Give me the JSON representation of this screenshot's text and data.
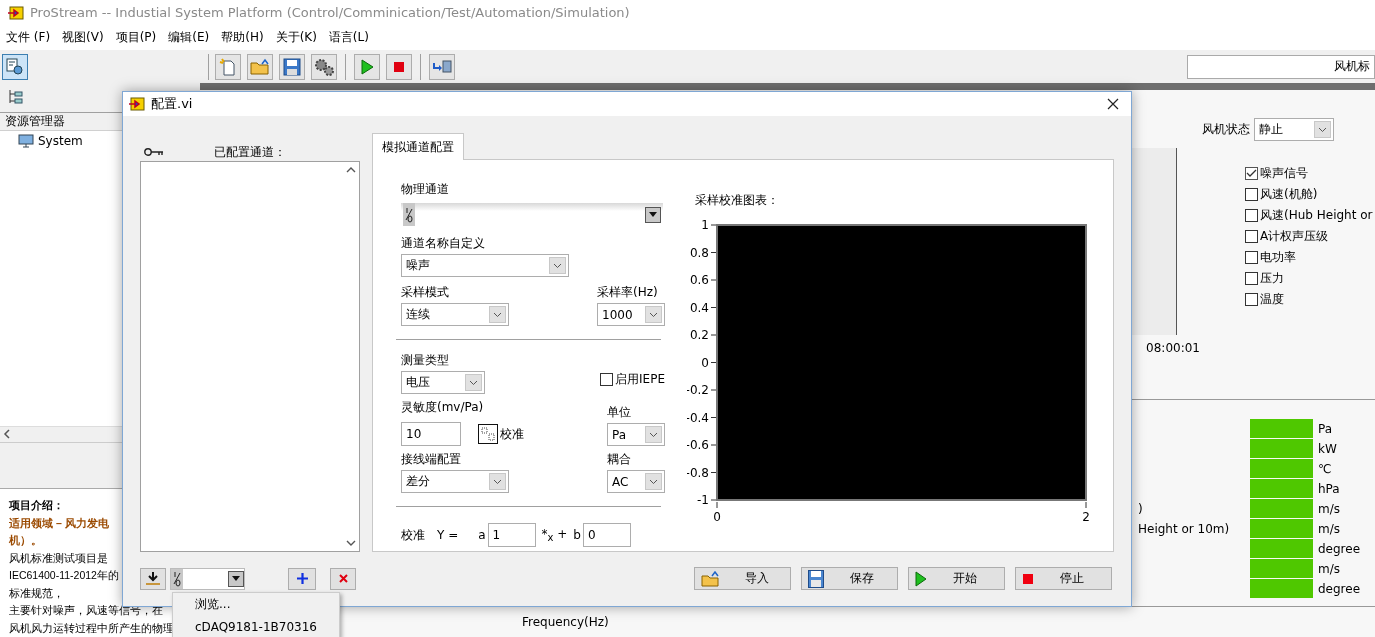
{
  "window": {
    "title": "ProStream -- Industial System Platform (Control/Comminication/Test/Automation/Simulation)"
  },
  "menu": [
    "文件 (F)",
    "视图(V)",
    "项目(P)",
    "编辑(E)",
    "帮助(H)",
    "关于(K)",
    "语言(L)"
  ],
  "toolbar": {
    "buttons": [
      {
        "kind": "explorer",
        "selected": true
      },
      {
        "kind": "new",
        "selected": false
      },
      {
        "kind": "open",
        "selected": false
      },
      {
        "kind": "save",
        "selected": false
      },
      {
        "kind": "settings",
        "selected": false
      },
      {
        "kind": "run",
        "selected": false
      },
      {
        "kind": "stop",
        "selected": false
      },
      {
        "kind": "export",
        "selected": false
      }
    ],
    "search_field": {
      "value": "风机标"
    }
  },
  "sidebar": {
    "header": "资源管理器",
    "items": [
      {
        "label": "System"
      }
    ]
  },
  "intro": {
    "title": "项目介绍：",
    "lines": [
      {
        "text": "适用领域 – 风力发电",
        "kind": "accent"
      },
      {
        "text": "机）。",
        "kind": "accent"
      },
      {
        "text": "风机标准测试项目是",
        "kind": "body"
      },
      {
        "text": "IEC61400-11-2012年的",
        "kind": "body"
      },
      {
        "text": "标准规范，",
        "kind": "body"
      },
      {
        "text": "主要针对噪声，风速等信号，在",
        "kind": "body"
      },
      {
        "text": "风机风力运转过程中所产生的物理",
        "kind": "body"
      }
    ]
  },
  "status": {
    "label": "风机状态",
    "value": "静止"
  },
  "signals": [
    {
      "label": "噪声信号",
      "checked": true
    },
    {
      "label": "风速(机舱)",
      "checked": false
    },
    {
      "label": "风速(Hub Height or",
      "checked": false
    },
    {
      "label": "A计权声压级",
      "checked": false
    },
    {
      "label": "电功率",
      "checked": false
    },
    {
      "label": "压力",
      "checked": false
    },
    {
      "label": "温度",
      "checked": false
    }
  ],
  "time_tick": "08:00:01",
  "legend_lines": [
    ")",
    "Height or 10m)"
  ],
  "units": [
    "Pa",
    "kW",
    "℃",
    "hPa",
    "m/s",
    "m/s",
    "degree",
    "m/s",
    "degree"
  ],
  "frequency_label": "Frequency(Hz)",
  "dialog": {
    "title": "配置.vi",
    "configured_label": "已配置通道：",
    "tabs": [
      {
        "label": "模拟通道配置",
        "selected": true
      }
    ],
    "form": {
      "physical_channel": {
        "label": "物理通道"
      },
      "channel_name": {
        "label": "通道名称自定义",
        "value": "噪声"
      },
      "sample_mode": {
        "label": "采样模式",
        "value": "连续"
      },
      "sample_rate": {
        "label": "采样率(Hz)",
        "value": "1000"
      },
      "measure_type": {
        "label": "测量类型",
        "value": "电压"
      },
      "iepe": {
        "label": "启用IEPE",
        "checked": false
      },
      "sensitivity": {
        "label": "灵敏度(mv/Pa)",
        "value": "10"
      },
      "calibrate_button": "校准",
      "unit": {
        "label": "单位",
        "value": "Pa"
      },
      "terminal": {
        "label": "接线端配置",
        "value": "差分"
      },
      "coupling": {
        "label": "耦合",
        "value": "AC"
      },
      "calibration": {
        "label": "校准",
        "equation": "Y =",
        "a_label": "a",
        "a": "1",
        "x_term": "*$_{x}$ +",
        "b_label": "b",
        "b": "0"
      }
    },
    "chart_data": {
      "type": "line",
      "title": "采样校准图表：",
      "xlim": [
        0,
        2
      ],
      "ylim": [
        -1,
        1
      ],
      "xticks": [
        0,
        2
      ],
      "yticks": [
        1,
        0.8,
        0.6,
        0.4,
        0.2,
        0,
        -0.2,
        -0.4,
        -0.6,
        -0.8,
        -1
      ]
    },
    "buttons": [
      {
        "label": "导入",
        "kind": "import"
      },
      {
        "label": "保存",
        "kind": "save"
      },
      {
        "label": "开始",
        "kind": "start"
      },
      {
        "label": "停止",
        "kind": "stop"
      }
    ],
    "channel_menu": {
      "items": [
        "浏览...",
        "cDAQ9181-1B70316"
      ]
    }
  }
}
